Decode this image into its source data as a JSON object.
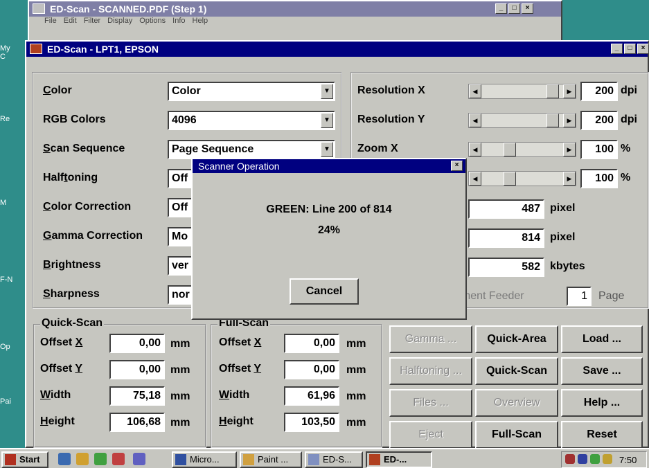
{
  "desktop": {
    "icons": [
      "My C",
      "Re",
      "M",
      "F-N",
      "Op",
      "Pai"
    ]
  },
  "outer_window": {
    "title": "ED-Scan - SCANNED.PDF (Step 1)",
    "menu": [
      "File",
      "Edit",
      "Filter",
      "Display",
      "Options",
      "Info",
      "Help"
    ],
    "min": "_",
    "max": "□",
    "close": "×"
  },
  "main_window": {
    "title": "ED-Scan - LPT1, EPSON",
    "min": "_",
    "max": "□",
    "close": "×"
  },
  "settings": [
    {
      "label_pre": "",
      "label_u": "C",
      "label_post": "olor",
      "value": "Color",
      "dropdown": true
    },
    {
      "label_pre": "RGB Colors",
      "label_u": "",
      "label_post": "",
      "value": "4096",
      "dropdown": true
    },
    {
      "label_pre": "",
      "label_u": "S",
      "label_post": "can Sequence",
      "value": "Page Sequence",
      "dropdown": true
    },
    {
      "label_pre": "Half",
      "label_u": "t",
      "label_post": "oning",
      "value": "Off",
      "dropdown": false
    },
    {
      "label_pre": "",
      "label_u": "C",
      "label_post": "olor Correction",
      "value": "Off",
      "dropdown": false
    },
    {
      "label_pre": "",
      "label_u": "G",
      "label_post": "amma Correction",
      "value": "Mo",
      "dropdown": false
    },
    {
      "label_pre": "",
      "label_u": "B",
      "label_post": "rightness",
      "value": "ver",
      "dropdown": false
    },
    {
      "label_pre": "",
      "label_u": "S",
      "label_post": "harpness",
      "value": "nor",
      "dropdown": false
    }
  ],
  "resolution": [
    {
      "label": "Resolution X",
      "value": "200",
      "unit": "dpi"
    },
    {
      "label": "Resolution Y",
      "value": "200",
      "unit": "dpi"
    },
    {
      "label": "Zoom X",
      "value": "100",
      "unit": "%"
    },
    {
      "label": "",
      "value": "100",
      "unit": "%"
    }
  ],
  "info": [
    {
      "value": "487",
      "unit": "pixel"
    },
    {
      "value": "814",
      "unit": "pixel"
    },
    {
      "value": "582",
      "unit": "kbytes"
    }
  ],
  "feeder": {
    "label": "ument Feeder",
    "pages": "1",
    "unit": "Page"
  },
  "quick_scan": {
    "title": "Quick-Scan",
    "rows": [
      {
        "pre": "Offset ",
        "u": "X",
        "post": "",
        "value": "0,00",
        "unit": "mm"
      },
      {
        "pre": "Offset ",
        "u": "Y",
        "post": "",
        "value": "0,00",
        "unit": "mm"
      },
      {
        "pre": "",
        "u": "W",
        "post": "idth",
        "value": "75,18",
        "unit": "mm"
      },
      {
        "pre": "",
        "u": "H",
        "post": "eight",
        "value": "106,68",
        "unit": "mm"
      }
    ]
  },
  "full_scan": {
    "title": "Full-Scan",
    "rows": [
      {
        "pre": "Offset ",
        "u": "X",
        "post": "",
        "value": "0,00",
        "unit": "mm"
      },
      {
        "pre": "Offset ",
        "u": "Y",
        "post": "",
        "value": "0,00",
        "unit": "mm"
      },
      {
        "pre": "",
        "u": "W",
        "post": "idth",
        "value": "61,96",
        "unit": "mm"
      },
      {
        "pre": "",
        "u": "H",
        "post": "eight",
        "value": "103,50",
        "unit": "mm"
      }
    ]
  },
  "buttons": [
    {
      "label": "Gamma ...",
      "disabled": true
    },
    {
      "label": "Quick-Area",
      "disabled": false
    },
    {
      "label": "Load ...",
      "disabled": false
    },
    {
      "label": "Halftoning ...",
      "disabled": true
    },
    {
      "label": "Quick-Scan",
      "disabled": false
    },
    {
      "label": "Save ...",
      "disabled": false
    },
    {
      "label": "Files ...",
      "disabled": true
    },
    {
      "label": "Overview",
      "disabled": true
    },
    {
      "label": "Help ...",
      "disabled": false
    },
    {
      "label": "Eject",
      "disabled": true
    },
    {
      "label": "Full-Scan",
      "disabled": false
    },
    {
      "label": "Reset",
      "disabled": false
    }
  ],
  "dialog": {
    "title": "Scanner Operation",
    "status": "GREEN: Line 200 of 814",
    "percent": "24%",
    "progress": 0.24,
    "cancel": "Cancel",
    "close": "×"
  },
  "taskbar": {
    "start": "Start",
    "tasks": [
      "Micro...",
      "Paint ...",
      "ED-S...",
      "ED-..."
    ],
    "clock": "7:50"
  },
  "colors": {
    "titlebar": "#000080",
    "desktop": "#2f8d8a",
    "face": "#c6c6c0"
  }
}
